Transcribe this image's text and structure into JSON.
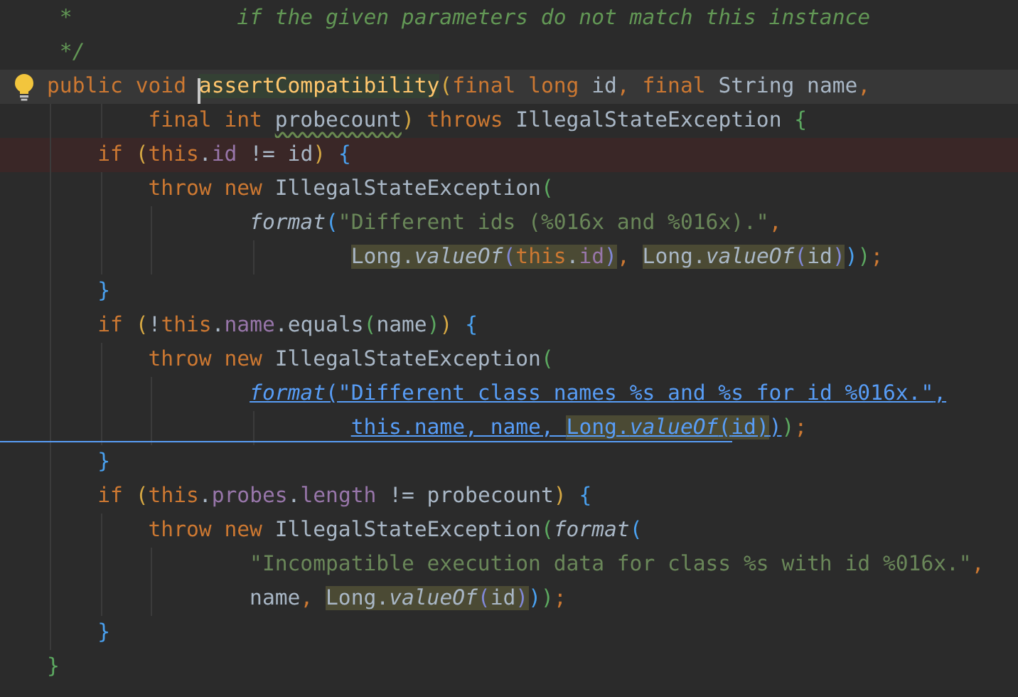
{
  "editor": {
    "lines": [
      {
        "kind": "member",
        "current": false,
        "error": false,
        "bulb": false,
        "hover_rule": false,
        "tokens": [
          {
            "text": " *             if the given parameters do not match this instance",
            "kind": "doc"
          }
        ]
      },
      {
        "kind": "member",
        "current": false,
        "error": false,
        "bulb": false,
        "hover_rule": false,
        "tokens": [
          {
            "text": " */",
            "kind": "doc"
          }
        ]
      },
      {
        "kind": "member",
        "current": true,
        "error": false,
        "bulb": true,
        "hover_rule": false,
        "tokens": [
          {
            "text": "public void ",
            "kind": "kw"
          },
          {
            "text": "assertCompatibility",
            "kind": "decl",
            "highlighted": true,
            "caret": true
          },
          {
            "text": "(",
            "kind": "b1"
          },
          {
            "text": "final long ",
            "kind": "kw"
          },
          {
            "text": "id",
            "kind": "id"
          },
          {
            "text": ", final ",
            "kind": "kw"
          },
          {
            "text": "String name",
            "kind": "id"
          },
          {
            "text": ",",
            "kind": "kw"
          }
        ]
      },
      {
        "kind": "nested",
        "current": false,
        "error": false,
        "bulb": false,
        "hover_rule": false,
        "tokens": [
          {
            "text": "final int ",
            "kind": "kw"
          },
          {
            "text": "probecount",
            "kind": "id",
            "typo": true
          },
          {
            "text": ")",
            "kind": "b1"
          },
          {
            "text": " throws ",
            "kind": "kw"
          },
          {
            "text": "IllegalStateException ",
            "kind": "id"
          },
          {
            "text": "{",
            "kind": "b2"
          }
        ]
      },
      {
        "kind": "statement",
        "current": false,
        "error": true,
        "bulb": false,
        "hover_rule": false,
        "tokens": [
          {
            "text": "if ",
            "kind": "kw"
          },
          {
            "text": "(",
            "kind": "b1"
          },
          {
            "text": "this",
            "kind": "kw"
          },
          {
            "text": ".",
            "kind": "id"
          },
          {
            "text": "id",
            "kind": "field"
          },
          {
            "text": " != id",
            "kind": "id"
          },
          {
            "text": ") ",
            "kind": "b1"
          },
          {
            "text": "{",
            "kind": "b3"
          }
        ]
      },
      {
        "kind": "nested",
        "current": false,
        "error": false,
        "bulb": false,
        "hover_rule": false,
        "tokens": [
          {
            "text": "throw new ",
            "kind": "kw"
          },
          {
            "text": "IllegalStateException",
            "kind": "id"
          },
          {
            "text": "(",
            "kind": "b2"
          }
        ]
      },
      {
        "kind": "argument",
        "current": false,
        "error": false,
        "bulb": false,
        "hover_rule": false,
        "tokens": [
          {
            "text": "format",
            "kind": "call"
          },
          {
            "text": "(",
            "kind": "b3"
          },
          {
            "text": "\"Different ids (%016x and %016x).\"",
            "kind": "str"
          },
          {
            "text": ",",
            "kind": "kw"
          }
        ]
      },
      {
        "kind": "argument-deep",
        "current": false,
        "error": false,
        "bulb": false,
        "hover_rule": false,
        "tokens": [
          {
            "text": "Long.",
            "kind": "id",
            "highlighted": true
          },
          {
            "text": "valueOf",
            "kind": "call",
            "highlighted": true
          },
          {
            "text": "(",
            "kind": "b4",
            "highlighted": true
          },
          {
            "text": "this",
            "kind": "kw",
            "highlighted": true
          },
          {
            "text": ".",
            "kind": "id",
            "highlighted": true
          },
          {
            "text": "id",
            "kind": "field",
            "highlighted": true
          },
          {
            "text": ")",
            "kind": "b4",
            "highlighted": true
          },
          {
            "text": ", ",
            "kind": "kw"
          },
          {
            "text": "Long.",
            "kind": "id",
            "highlighted": true
          },
          {
            "text": "valueOf",
            "kind": "call",
            "highlighted": true
          },
          {
            "text": "(",
            "kind": "b4",
            "highlighted": true
          },
          {
            "text": "id",
            "kind": "id",
            "highlighted": true
          },
          {
            "text": ")",
            "kind": "b4",
            "highlighted": true
          },
          {
            "text": ")",
            "kind": "b3"
          },
          {
            "text": ")",
            "kind": "b2"
          },
          {
            "text": ";",
            "kind": "kw"
          }
        ]
      },
      {
        "kind": "statement",
        "current": false,
        "error": false,
        "bulb": false,
        "hover_rule": false,
        "tokens": [
          {
            "text": "}",
            "kind": "b3"
          }
        ]
      },
      {
        "kind": "statement",
        "current": false,
        "error": false,
        "bulb": false,
        "hover_rule": false,
        "tokens": [
          {
            "text": "if ",
            "kind": "kw"
          },
          {
            "text": "(",
            "kind": "b1"
          },
          {
            "text": "!",
            "kind": "id"
          },
          {
            "text": "this",
            "kind": "kw"
          },
          {
            "text": ".",
            "kind": "id"
          },
          {
            "text": "name",
            "kind": "field"
          },
          {
            "text": ".equals",
            "kind": "id"
          },
          {
            "text": "(",
            "kind": "b2"
          },
          {
            "text": "name",
            "kind": "id"
          },
          {
            "text": ")",
            "kind": "b2"
          },
          {
            "text": ") ",
            "kind": "b1"
          },
          {
            "text": "{",
            "kind": "b3"
          }
        ]
      },
      {
        "kind": "nested",
        "current": false,
        "error": false,
        "bulb": false,
        "hover_rule": false,
        "tokens": [
          {
            "text": "throw new ",
            "kind": "kw"
          },
          {
            "text": "IllegalStateException",
            "kind": "id"
          },
          {
            "text": "(",
            "kind": "b2"
          }
        ]
      },
      {
        "kind": "argument",
        "current": false,
        "error": false,
        "bulb": false,
        "hover_rule": false,
        "tokens": [
          {
            "text": "format",
            "kind": "call",
            "link": true
          },
          {
            "text": "(",
            "kind": "b3",
            "link": true
          },
          {
            "text": "\"Different class names %s and %s for id %016x.\"",
            "kind": "str",
            "link": true
          },
          {
            "text": ",",
            "kind": "kw",
            "link": true
          }
        ]
      },
      {
        "kind": "argument-deep",
        "current": false,
        "error": false,
        "bulb": false,
        "hover_rule": true,
        "tokens": [
          {
            "text": "this.name, name, ",
            "kind": "id",
            "link": true
          },
          {
            "text": "Long.",
            "kind": "id",
            "link": true,
            "highlighted": true
          },
          {
            "text": "valueOf",
            "kind": "call",
            "link": true,
            "highlighted": true
          },
          {
            "text": "(",
            "kind": "b4",
            "link": true,
            "highlighted": true
          },
          {
            "text": "id",
            "kind": "id",
            "link": true,
            "highlighted": true
          },
          {
            "text": ")",
            "kind": "b4",
            "link": true,
            "highlighted": true
          },
          {
            "text": ")",
            "kind": "b3",
            "link": true
          },
          {
            "text": ")",
            "kind": "b2"
          },
          {
            "text": ";",
            "kind": "kw"
          }
        ]
      },
      {
        "kind": "statement",
        "current": false,
        "error": false,
        "bulb": false,
        "hover_rule": false,
        "tokens": [
          {
            "text": "}",
            "kind": "b3"
          }
        ]
      },
      {
        "kind": "statement",
        "current": false,
        "error": false,
        "bulb": false,
        "hover_rule": false,
        "tokens": [
          {
            "text": "if ",
            "kind": "kw"
          },
          {
            "text": "(",
            "kind": "b1"
          },
          {
            "text": "this",
            "kind": "kw"
          },
          {
            "text": ".",
            "kind": "id"
          },
          {
            "text": "probes",
            "kind": "field"
          },
          {
            "text": ".",
            "kind": "id"
          },
          {
            "text": "length",
            "kind": "field"
          },
          {
            "text": " != probecount",
            "kind": "id"
          },
          {
            "text": ") ",
            "kind": "b1"
          },
          {
            "text": "{",
            "kind": "b3"
          }
        ]
      },
      {
        "kind": "nested",
        "current": false,
        "error": false,
        "bulb": false,
        "hover_rule": false,
        "tokens": [
          {
            "text": "throw new ",
            "kind": "kw"
          },
          {
            "text": "IllegalStateException",
            "kind": "id"
          },
          {
            "text": "(",
            "kind": "b2"
          },
          {
            "text": "format",
            "kind": "call"
          },
          {
            "text": "(",
            "kind": "b3"
          }
        ]
      },
      {
        "kind": "argument",
        "current": false,
        "error": false,
        "bulb": false,
        "hover_rule": false,
        "tokens": [
          {
            "text": "\"Incompatible execution data for class %s with id %016x.\"",
            "kind": "str"
          },
          {
            "text": ",",
            "kind": "kw"
          }
        ]
      },
      {
        "kind": "argument",
        "current": false,
        "error": false,
        "bulb": false,
        "hover_rule": false,
        "tokens": [
          {
            "text": "name",
            "kind": "id"
          },
          {
            "text": ", ",
            "kind": "kw"
          },
          {
            "text": "Long.",
            "kind": "id",
            "highlighted": true
          },
          {
            "text": "valueOf",
            "kind": "call",
            "highlighted": true
          },
          {
            "text": "(",
            "kind": "b4",
            "highlighted": true
          },
          {
            "text": "id",
            "kind": "id",
            "highlighted": true
          },
          {
            "text": ")",
            "kind": "b4",
            "highlighted": true
          },
          {
            "text": ")",
            "kind": "b3"
          },
          {
            "text": ")",
            "kind": "b2"
          },
          {
            "text": ";",
            "kind": "kw"
          }
        ]
      },
      {
        "kind": "statement",
        "current": false,
        "error": false,
        "bulb": false,
        "hover_rule": false,
        "tokens": [
          {
            "text": "}",
            "kind": "b3"
          }
        ]
      },
      {
        "kind": "member",
        "current": false,
        "error": false,
        "bulb": false,
        "hover_rule": false,
        "tokens": [
          {
            "text": "}",
            "kind": "b2"
          }
        ]
      }
    ]
  }
}
